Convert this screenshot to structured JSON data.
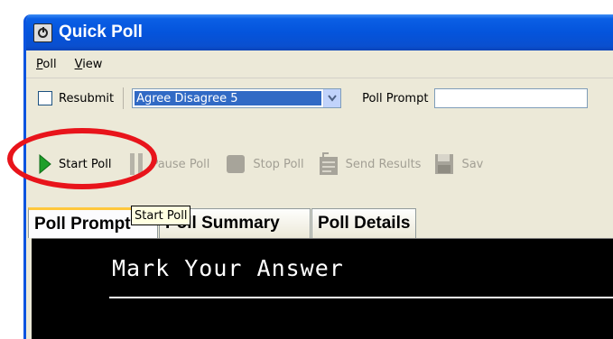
{
  "window": {
    "title": "Quick Poll",
    "title_icon": "quick-poll-app-icon"
  },
  "menu": {
    "items": [
      {
        "label": "Poll",
        "mnemonic": "P"
      },
      {
        "label": "View",
        "mnemonic": "V"
      }
    ]
  },
  "options": {
    "resubmit_label": "Resubmit",
    "resubmit_checked": false,
    "poll_type_value": "Agree Disagree 5",
    "prompt_label": "Poll Prompt",
    "prompt_value": ""
  },
  "toolbar": {
    "start_label": "Start Poll",
    "pause_label": "Pause Poll",
    "stop_label": "Stop Poll",
    "send_label": "Send Results",
    "save_label": "Sav",
    "start_color": "#1e9f2a",
    "disabled_color": "#a29f94"
  },
  "tooltip": {
    "text": "Start Poll"
  },
  "tabs": [
    {
      "label": "Poll Prompt",
      "active": true
    },
    {
      "label": "Poll Summary",
      "active": false
    },
    {
      "label": "Poll Details",
      "active": false
    }
  ],
  "prompt_display": {
    "heading": "Mark Your Answer"
  },
  "annotation": {
    "highlight_color": "#e8141b"
  }
}
